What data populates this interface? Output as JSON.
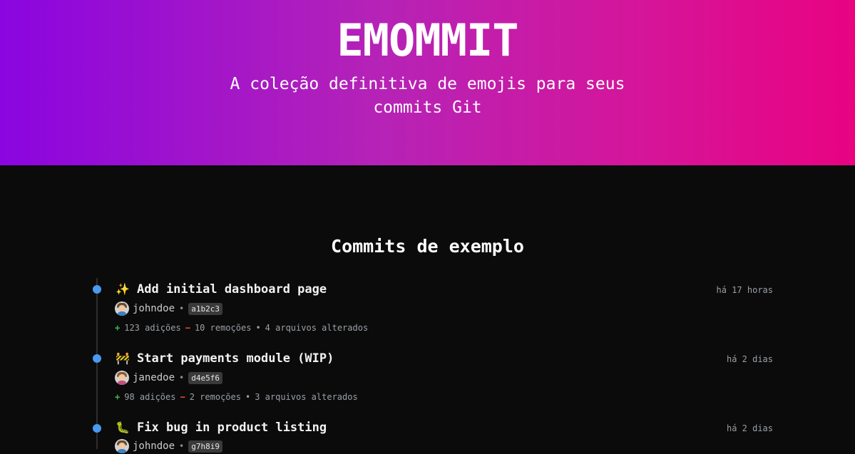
{
  "hero": {
    "title": "EMOMMIT",
    "subtitle": "A coleção definitiva de emojis para seus commits Git"
  },
  "section": {
    "title": "Commits de exemplo"
  },
  "commits": [
    {
      "emoji": "✨",
      "emoji_icon": "sparkles-icon",
      "message": "Add initial dashboard page",
      "time": "há 17 horas",
      "author": "johndoe",
      "hash": "a1b2c3",
      "additions": "123 adições",
      "removals": "10 remoções",
      "files": "4 arquivos alterados"
    },
    {
      "emoji": "🚧",
      "emoji_icon": "construction-icon",
      "message": "Start payments module (WIP)",
      "time": "há 2 dias",
      "author": "janedoe",
      "hash": "d4e5f6",
      "additions": "98 adições",
      "removals": "2 remoções",
      "files": "3 arquivos alterados"
    },
    {
      "emoji": "🐛",
      "emoji_icon": "bug-icon",
      "message": "Fix bug in product listing",
      "time": "há 2 dias",
      "author": "johndoe",
      "hash": "g7h8i9"
    }
  ],
  "symbols": {
    "plus": "+",
    "minus": "−",
    "bullet": "•",
    "dot_sep": "•"
  },
  "colors": {
    "gradient_start": "#8a05e0",
    "gradient_end": "#e80381",
    "background": "#0b0b0b",
    "timeline_dot": "#4a9af0",
    "additions": "#3fb950",
    "removals": "#f85149"
  }
}
